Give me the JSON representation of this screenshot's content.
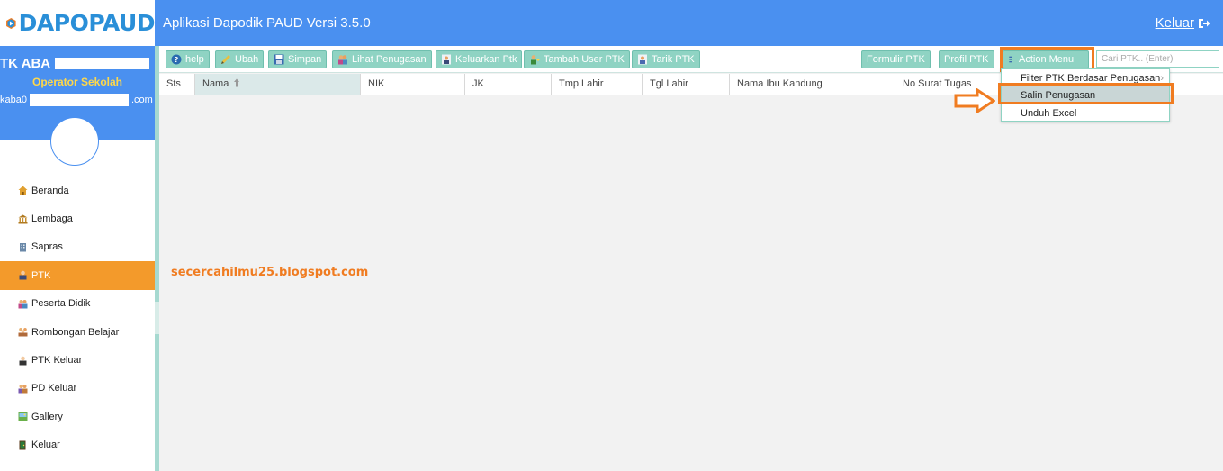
{
  "logo": {
    "text": "DAPOPAUD"
  },
  "header": {
    "title": "Aplikasi Dapodik PAUD Versi 3.5.0",
    "logout_label": "Keluar"
  },
  "profile": {
    "school_name": "TK ABA",
    "role": "Operator Sekolah",
    "email_prefix": "kaba0",
    "email_suffix": ".com"
  },
  "nav": [
    {
      "label": "Beranda",
      "icon": "home-icon",
      "active": false
    },
    {
      "label": "Lembaga",
      "icon": "institution-icon",
      "active": false
    },
    {
      "label": "Sapras",
      "icon": "facilities-icon",
      "active": false
    },
    {
      "label": "PTK",
      "icon": "teacher-icon",
      "active": true
    },
    {
      "label": "Peserta Didik",
      "icon": "students-icon",
      "active": false
    },
    {
      "label": "Rombongan Belajar",
      "icon": "class-group-icon",
      "active": false
    },
    {
      "label": "PTK Keluar",
      "icon": "teacher-out-icon",
      "active": false
    },
    {
      "label": "PD Keluar",
      "icon": "students-out-icon",
      "active": false
    },
    {
      "label": "Gallery",
      "icon": "gallery-icon",
      "active": false
    },
    {
      "label": "Keluar",
      "icon": "exit-icon",
      "active": false
    }
  ],
  "toolbar": {
    "help": "help",
    "ubah": "Ubah",
    "simpan": "Simpan",
    "lihat_penugasan": "Lihat Penugasan",
    "keluarkan_ptk": "Keluarkan Ptk",
    "tambah_user_ptk": "Tambah User PTK",
    "tarik_ptk": "Tarik PTK",
    "formulir_ptk": "Formulir PTK",
    "profil_ptk": "Profil PTK",
    "action_menu": "Action Menu",
    "search_placeholder": "Cari PTK.. (Enter)"
  },
  "grid": {
    "columns": [
      "Sts",
      "Nama",
      "NIK",
      "JK",
      "Tmp.Lahir",
      "Tgl Lahir",
      "Nama Ibu Kandung",
      "No Surat Tugas"
    ]
  },
  "action_menu_items": [
    "Filter PTK Berdasar Penugasan",
    "Salin Penugasan",
    "Unduh Excel"
  ],
  "watermark": "secercahilmu25.blogspot.com",
  "colors": {
    "header": "#4a90f0",
    "active_nav": "#f39a2b",
    "toolbar_button": "#8fd3c3",
    "highlight": "#f07c21",
    "role_text": "#ffd84a"
  }
}
